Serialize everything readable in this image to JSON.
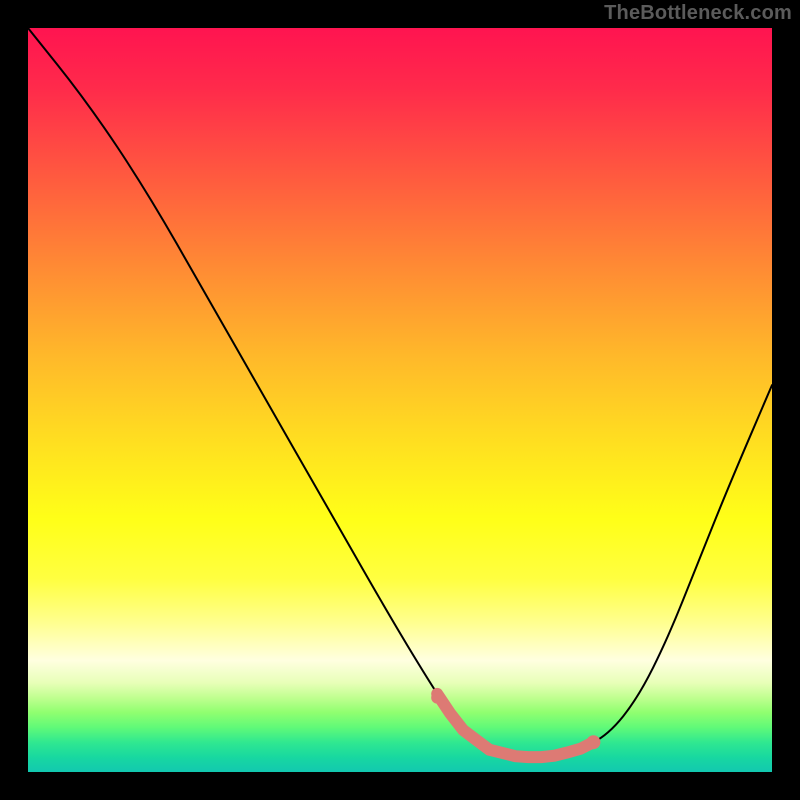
{
  "watermark": "TheBottleneck.com",
  "chart_data": {
    "type": "line",
    "title": "",
    "xlabel": "",
    "ylabel": "",
    "xlim": [
      0,
      100
    ],
    "ylim": [
      0,
      100
    ],
    "legend": false,
    "grid": false,
    "series": [
      {
        "name": "bottleneck-curve",
        "x": [
          0,
          8,
          16,
          24,
          32,
          40,
          48,
          54,
          58,
          62,
          66,
          70,
          74,
          78,
          82,
          86,
          90,
          94,
          100
        ],
        "values": [
          100,
          90,
          78,
          64,
          50,
          36,
          22,
          12,
          6,
          3,
          2,
          2,
          3,
          5,
          10,
          18,
          28,
          38,
          52
        ]
      }
    ],
    "annotations": [
      {
        "name": "trough-highlight",
        "x_start": 55,
        "x_end": 76,
        "color": "#dd7a74"
      },
      {
        "name": "trough-dot-left",
        "x": 55,
        "y": 10,
        "color": "#dd7a74"
      },
      {
        "name": "trough-dot-right",
        "x": 76,
        "y": 4,
        "color": "#dd7a74"
      }
    ],
    "background_gradient": {
      "orientation": "vertical",
      "stops": [
        {
          "pos": 0,
          "color": "#ff1450"
        },
        {
          "pos": 50,
          "color": "#ffd020"
        },
        {
          "pos": 85,
          "color": "#ffffe0"
        },
        {
          "pos": 100,
          "color": "#12c8b0"
        }
      ]
    }
  }
}
